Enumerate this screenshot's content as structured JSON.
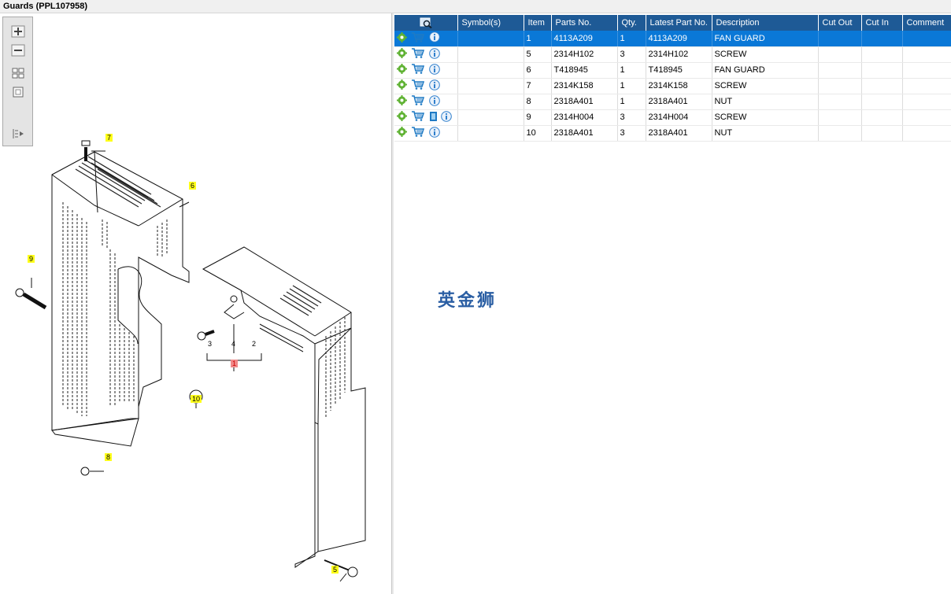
{
  "window": {
    "title": "Guards (PPL107958)"
  },
  "zoom_toolbar": {
    "buttons": [
      "zoom-in",
      "zoom-out",
      "fit-all",
      "fit-window",
      "toggle-list"
    ]
  },
  "drawing": {
    "callouts": {
      "c7": "7",
      "c6": "6",
      "c9": "9",
      "c10": "10",
      "c8": "8",
      "c5": "5",
      "c1": "1"
    },
    "sub_labels": {
      "s3": "3",
      "s4": "4",
      "s2": "2"
    }
  },
  "table": {
    "columns": {
      "symbols": "Symbol(s)",
      "item": "Item",
      "parts_no": "Parts No.",
      "qty": "Qty.",
      "latest": "Latest Part No.",
      "description": "Description",
      "cut_out": "Cut Out",
      "cut_in": "Cut In",
      "comment": "Comment"
    },
    "rows": [
      {
        "item": "1",
        "parts_no": "4113A209",
        "qty": "1",
        "latest": "4113A209",
        "description": "FAN GUARD",
        "cut_out": "",
        "cut_in": "",
        "comment": ""
      },
      {
        "item": "5",
        "parts_no": "2314H102",
        "qty": "3",
        "latest": "2314H102",
        "description": "SCREW",
        "cut_out": "",
        "cut_in": "",
        "comment": ""
      },
      {
        "item": "6",
        "parts_no": "T418945",
        "qty": "1",
        "latest": "T418945",
        "description": "FAN GUARD",
        "cut_out": "",
        "cut_in": "",
        "comment": ""
      },
      {
        "item": "7",
        "parts_no": "2314K158",
        "qty": "1",
        "latest": "2314K158",
        "description": "SCREW",
        "cut_out": "",
        "cut_in": "",
        "comment": ""
      },
      {
        "item": "8",
        "parts_no": "2318A401",
        "qty": "1",
        "latest": "2318A401",
        "description": "NUT",
        "cut_out": "",
        "cut_in": "",
        "comment": ""
      },
      {
        "item": "9",
        "parts_no": "2314H004",
        "qty": "3",
        "latest": "2314H004",
        "description": "SCREW",
        "cut_out": "",
        "cut_in": "",
        "comment": ""
      },
      {
        "item": "10",
        "parts_no": "2318A401",
        "qty": "3",
        "latest": "2318A401",
        "description": "NUT",
        "cut_out": "",
        "cut_in": "",
        "comment": ""
      }
    ],
    "row_icons": [
      "gear-icon",
      "cart-icon",
      "info-icon"
    ],
    "selected_row": 0
  },
  "watermark": "英金狮",
  "colors": {
    "header": "#1e5a96",
    "selected": "#0a78d7",
    "callout": "#ffff1a"
  }
}
